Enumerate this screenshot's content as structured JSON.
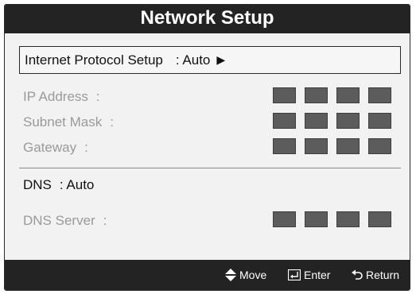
{
  "title": "Network Setup",
  "protocol": {
    "label": "Internet Protocol Setup",
    "value": ": Auto",
    "arrow_icon": "triangle-right-icon"
  },
  "fields": [
    {
      "label": "IP Address",
      "sep": ":"
    },
    {
      "label": "Subnet Mask",
      "sep": ":"
    },
    {
      "label": "Gateway",
      "sep": ":"
    }
  ],
  "dns": {
    "label": "DNS",
    "value": ": Auto"
  },
  "dns_server": {
    "label": "DNS Server",
    "sep": ":"
  },
  "footer": {
    "move": "Move",
    "enter": "Enter",
    "return": "Return"
  },
  "colors": {
    "header_bg": "#232323",
    "panel_bg": "#f2f2f2",
    "disabled_text": "#9a9a9a",
    "octet_box": "#5c5c5c"
  }
}
